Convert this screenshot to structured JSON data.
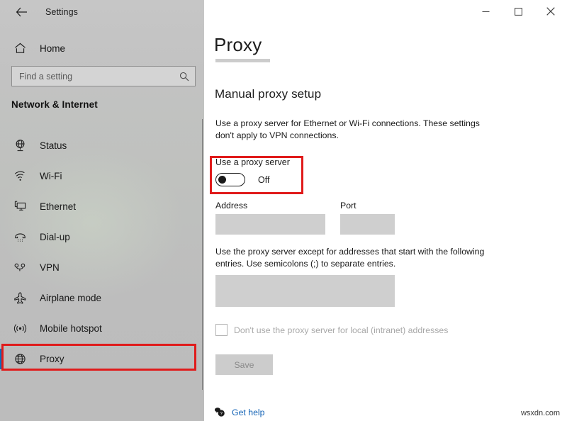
{
  "window": {
    "title": "Settings",
    "back_icon": "back-arrow-icon",
    "controls": {
      "minimize": "minimize-icon",
      "maximize": "maximize-icon",
      "close": "close-icon"
    }
  },
  "sidebar": {
    "home_label": "Home",
    "home_icon": "home-icon",
    "search": {
      "placeholder": "Find a setting",
      "value": "",
      "icon": "search-icon"
    },
    "section_title": "Network & Internet",
    "items": [
      {
        "label": "Status",
        "icon": "globe-status-icon",
        "selected": false
      },
      {
        "label": "Wi-Fi",
        "icon": "wifi-icon",
        "selected": false
      },
      {
        "label": "Ethernet",
        "icon": "ethernet-monitor-icon",
        "selected": false
      },
      {
        "label": "Dial-up",
        "icon": "dialup-phone-icon",
        "selected": false
      },
      {
        "label": "VPN",
        "icon": "vpn-icon",
        "selected": false
      },
      {
        "label": "Airplane mode",
        "icon": "airplane-icon",
        "selected": false
      },
      {
        "label": "Mobile hotspot",
        "icon": "hotspot-icon",
        "selected": false
      },
      {
        "label": "Proxy",
        "icon": "proxy-globe-icon",
        "selected": true
      }
    ],
    "selection_accent": "#0a6ebd"
  },
  "main": {
    "page_title": "Proxy",
    "subsection_title": "Manual proxy setup",
    "intro_text": "Use a proxy server for Ethernet or Wi-Fi connections. These settings don't apply to VPN connections.",
    "toggle": {
      "label": "Use a proxy server",
      "state": "Off",
      "checked": false
    },
    "address": {
      "label": "Address",
      "value": "",
      "placeholder": ""
    },
    "port": {
      "label": "Port",
      "value": "",
      "placeholder": ""
    },
    "exceptions_text": "Use the proxy server except for addresses that start with the following entries. Use semicolons (;) to separate entries.",
    "exceptions_input": {
      "value": "",
      "placeholder": ""
    },
    "local_checkbox": {
      "label": "Don't use the proxy server for local (intranet) addresses",
      "checked": false
    },
    "save_label": "Save",
    "get_help": {
      "label": "Get help",
      "icon": "help-chat-icon",
      "color": "#1061b5"
    }
  },
  "annotations": {
    "color": "#e01b1b",
    "boxes": [
      "use-a-proxy-server-toggle",
      "sidebar-item-proxy"
    ]
  },
  "watermark": "wsxdn.com"
}
